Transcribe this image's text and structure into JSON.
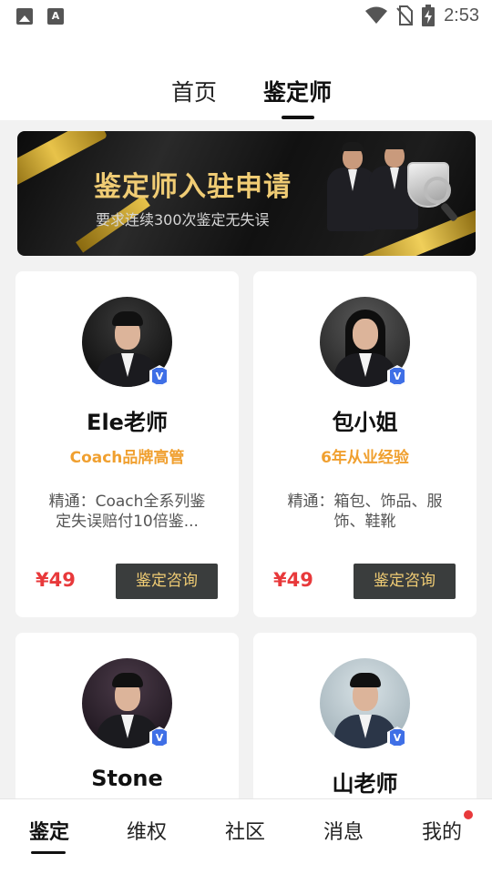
{
  "status_bar": {
    "time": "2:53",
    "left_icons": [
      "image-icon",
      "text-a-icon"
    ],
    "right_icons": [
      "wifi-icon",
      "no-sim-icon",
      "battery-charging-icon"
    ]
  },
  "header": {
    "tabs": [
      {
        "label": "首页",
        "active": false
      },
      {
        "label": "鉴定师",
        "active": true
      }
    ]
  },
  "banner": {
    "title": "鉴定师入驻申请",
    "subtitle": "要求连续300次鉴定无失误"
  },
  "appraisers": [
    {
      "name": "Ele老师",
      "tagline": "Coach品牌高管",
      "description": "精通：Coach全系列鉴定失误赔付10倍鉴...",
      "price": "¥49",
      "button": "鉴定咨询"
    },
    {
      "name": "包小姐",
      "tagline": "6年从业经验",
      "description": "精通：箱包、饰品、服饰、鞋靴",
      "price": "¥49",
      "button": "鉴定咨询"
    },
    {
      "name": "Stone"
    },
    {
      "name": "山老师"
    }
  ],
  "verified_badge": "V",
  "bottom_nav": {
    "items": [
      {
        "label": "鉴定",
        "active": true
      },
      {
        "label": "维权",
        "active": false
      },
      {
        "label": "社区",
        "active": false
      },
      {
        "label": "消息",
        "active": false
      },
      {
        "label": "我的",
        "active": false,
        "notification_dot": true
      }
    ]
  },
  "colors": {
    "accent_gold": "#f0cc74",
    "tagline_orange": "#f0a030",
    "price_red": "#e8393b",
    "button_bg": "#3a3d3d",
    "verified_blue": "#3f6fe6"
  }
}
